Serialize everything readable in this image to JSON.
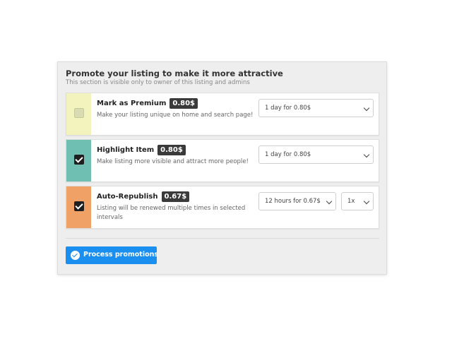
{
  "section": {
    "title": "Promote your listing to make it more attractive",
    "subtitle": "This section is visible only to owner of this listing and admins"
  },
  "promotions": [
    {
      "name": "Mark as Premium",
      "price": "0.80$",
      "description": "Make your listing unique on home and search page!",
      "color": "#f3f3bd",
      "checked": false,
      "duration": "1 day for 0.80$"
    },
    {
      "name": "Highlight Item",
      "price": "0.80$",
      "description": "Make listing more visible and attract more people!",
      "color": "#6fbfb2",
      "checked": true,
      "duration": "1 day for 0.80$"
    },
    {
      "name": "Auto-Republish",
      "price": "0.67$",
      "description": "Listing will be renewed multiple times in selected intervals",
      "color": "#f0a266",
      "checked": true,
      "duration": "12 hours for 0.67$",
      "repeat": "1x"
    }
  ],
  "actions": {
    "process_label": "Process promotions",
    "process_icon": "check-circle-icon",
    "accent": "#1a8ff0"
  }
}
